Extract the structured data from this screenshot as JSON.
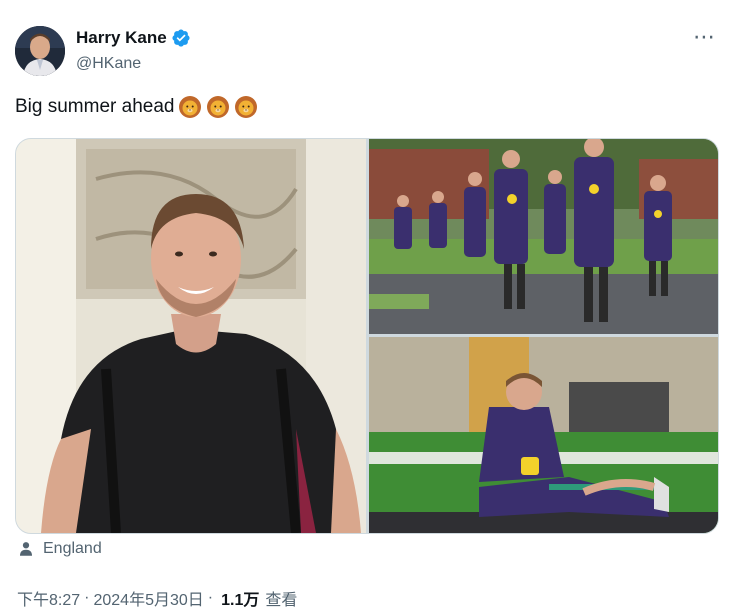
{
  "author": {
    "display_name": "Harry Kane",
    "handle": "@HKane",
    "verified": true,
    "avatar_icon": "profile-photo"
  },
  "tweet": {
    "text": "Big summer ahead",
    "emojis": [
      "lion-face",
      "lion-face",
      "lion-face"
    ]
  },
  "more_icon": "⋯",
  "media": [
    {
      "name": "photo-portrait",
      "description_icon": "photo"
    },
    {
      "name": "photo-training-walk",
      "description_icon": "photo"
    },
    {
      "name": "photo-stretching",
      "description_icon": "photo"
    }
  ],
  "location": {
    "icon": "person-icon",
    "label": "England"
  },
  "meta": {
    "time": "下午8:27",
    "separator": "·",
    "date": "2024年5月30日",
    "views_count": "1.1万",
    "views_label": "查看"
  },
  "colors": {
    "verified_blue": "#1d9bf0",
    "secondary_text": "#536471",
    "kit_purple": "#3a2f6e",
    "grass": "#5c9a3a"
  }
}
